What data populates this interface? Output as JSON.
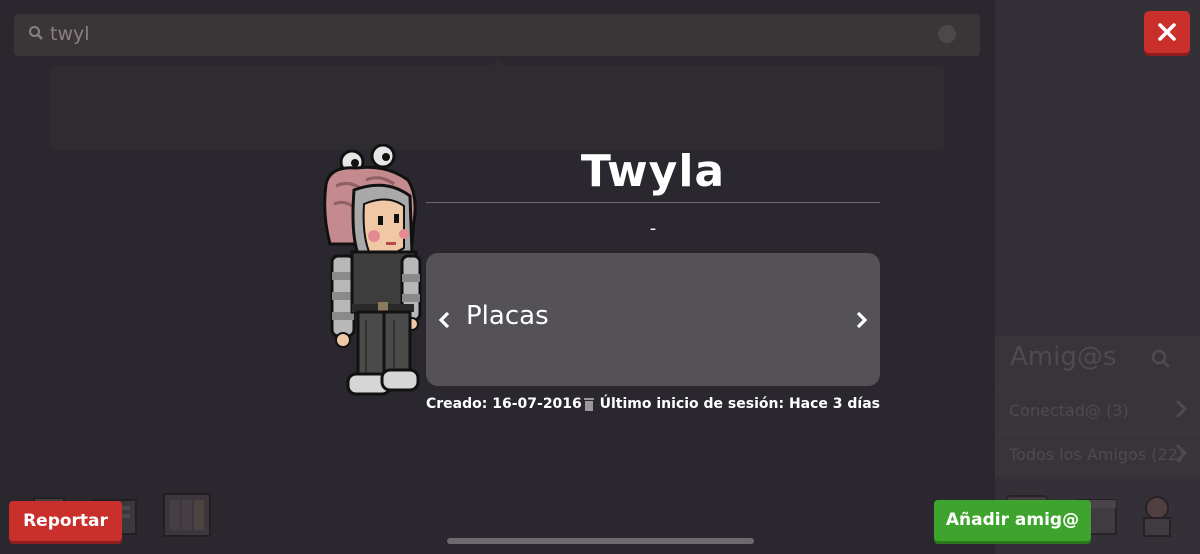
{
  "search": {
    "value": "twyl"
  },
  "friends_panel": {
    "title": "Amig@s",
    "rows": [
      {
        "label": "Conectad@ (3)"
      },
      {
        "label": "Todos los Amigos (22)"
      }
    ]
  },
  "profile": {
    "name": "Twyla",
    "motto": "-",
    "badges_label": "Placas",
    "created": "Creado: 16-07-2016",
    "last_login": "Último inicio de sesión: Hace 3 días"
  },
  "buttons": {
    "close_label": "✕",
    "report_label": "Reportar",
    "add_friend_label": "Añadir amig@"
  },
  "colors": {
    "accent_red": "#c9302c",
    "accent_green": "#3fa42d",
    "background": "#2a282e",
    "card": "#545157"
  }
}
